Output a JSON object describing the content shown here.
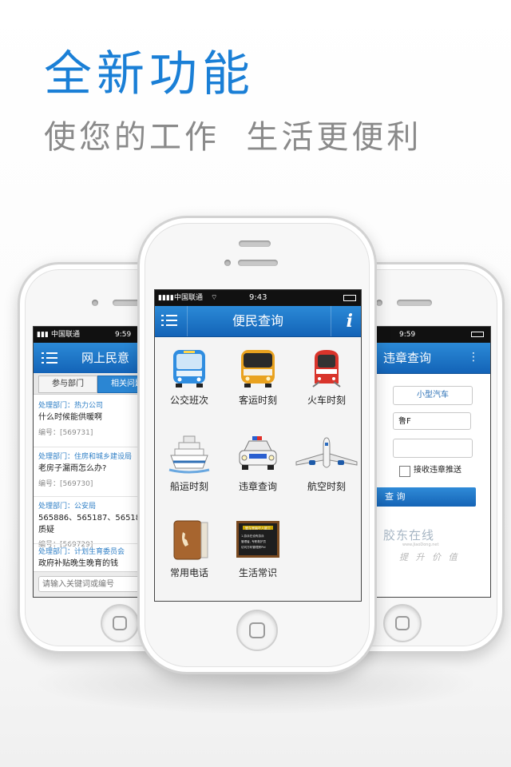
{
  "headline": "全新功能",
  "subline": "使您的工作  生活更便利",
  "left_phone": {
    "status": {
      "carrier": "中国联通",
      "time": "9:59"
    },
    "title": "网上民意",
    "tabs": [
      "参与部门",
      "相关问题"
    ],
    "items": [
      {
        "dept": "处理部门：热力公司",
        "question": "什么时候能供暖啊",
        "number": "编号：[569731]"
      },
      {
        "dept": "处理部门：住房和城乡建设局",
        "question": "老房子漏雨怎么办?",
        "number": "编号：[569730]"
      },
      {
        "dept": "处理部门：公安局",
        "question": "565886、565187、565186 质疑",
        "number": "编号：[569729]"
      },
      {
        "dept": "处理部门：计划生育委员会",
        "question": "政府补贴晚生晚育的钱",
        "number": ""
      }
    ],
    "search_placeholder": "请输入关键词或编号"
  },
  "center_phone": {
    "status": {
      "carrier": "中国联通",
      "time": "9:43"
    },
    "title": "便民查询",
    "info_icon": "i",
    "grid": [
      {
        "label": "公交班次",
        "icon": "bus-icon"
      },
      {
        "label": "客运时刻",
        "icon": "coach-icon"
      },
      {
        "label": "火车时刻",
        "icon": "train-icon"
      },
      {
        "label": "船运时刻",
        "icon": "ship-icon"
      },
      {
        "label": "违章查询",
        "icon": "police-car-icon"
      },
      {
        "label": "航空时刻",
        "icon": "airplane-icon"
      },
      {
        "label": "常用电话",
        "icon": "phonebook-icon"
      },
      {
        "label": "生活常识",
        "icon": "blackboard-icon"
      }
    ],
    "board_lines": [
      "管车里面吓人能工",
      "1.游泳在设有游泳",
      "管理者,  专职救护员",
      "访问万利管理房Pid"
    ]
  },
  "right_phone": {
    "status": {
      "time": "9:59"
    },
    "title": "违章查询",
    "vehicle_type": "小型汽车",
    "plate_prefix": "鲁F",
    "push_label": "接收违章推送",
    "query_button": "查 询",
    "watermark_main": "胶东在线",
    "watermark_url": "www.JiaoDong.net",
    "watermark_slogan": "提 升 价 值"
  }
}
